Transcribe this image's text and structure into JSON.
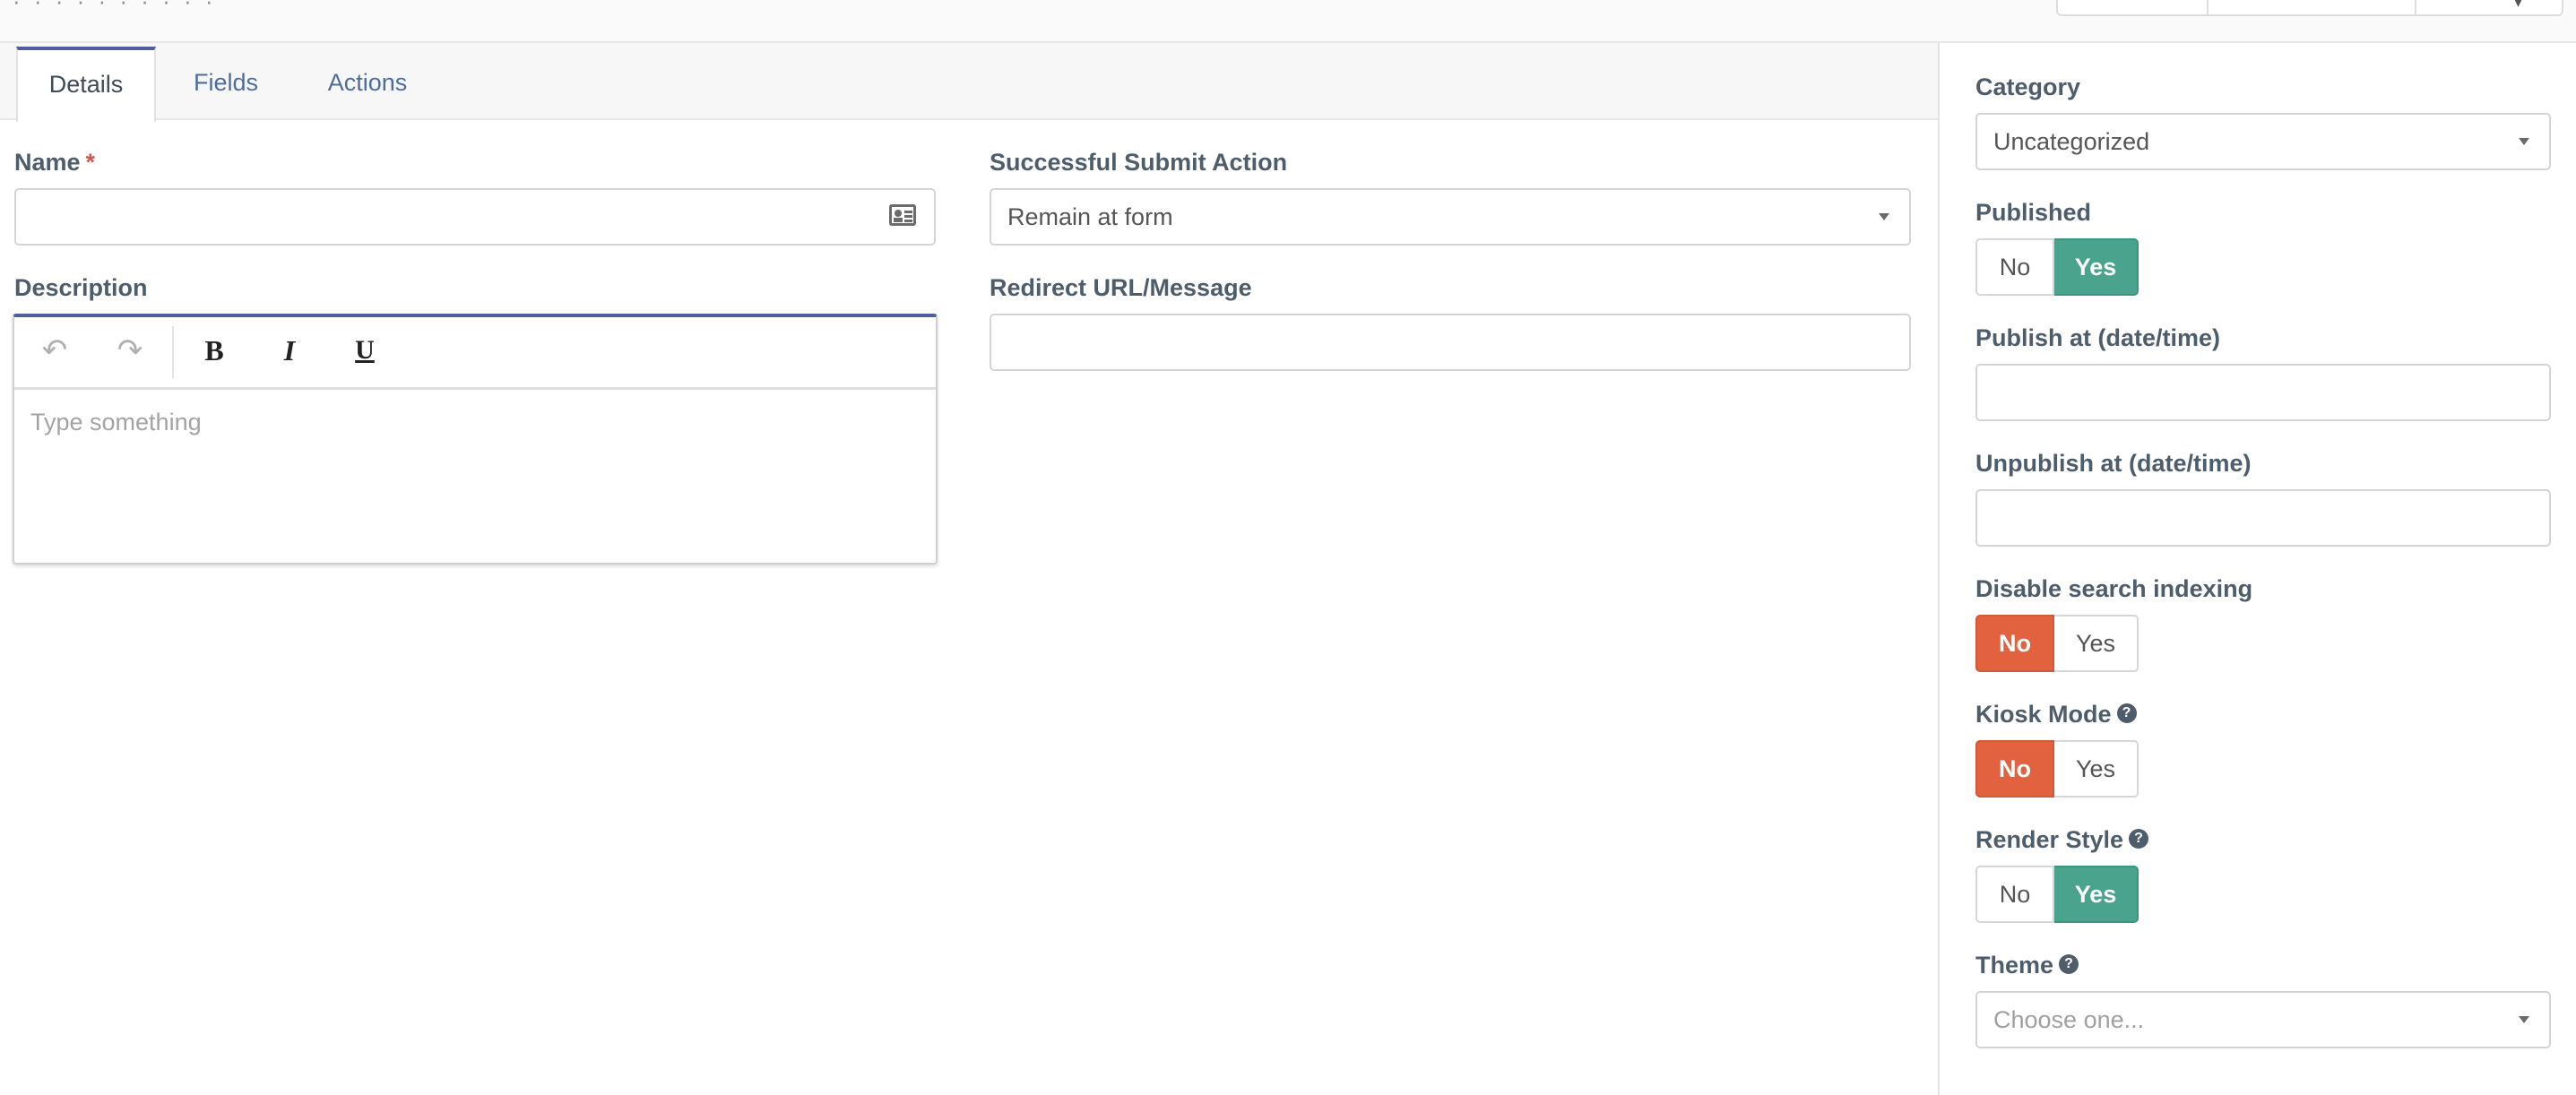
{
  "topbar": {
    "ghost_text": "· · · · · · · · · ·",
    "menu_glyph": "▾"
  },
  "tabs": [
    {
      "label": "Details",
      "active": true
    },
    {
      "label": "Fields",
      "active": false
    },
    {
      "label": "Actions",
      "active": false
    }
  ],
  "form": {
    "name": {
      "label": "Name",
      "required_mark": "*",
      "value": "",
      "icon": "contact-card-icon"
    },
    "description": {
      "label": "Description",
      "placeholder": "Type something",
      "toolbar": {
        "undo": "↶",
        "redo": "↷",
        "bold": "B",
        "italic": "I",
        "underline": "U"
      }
    },
    "submit_action": {
      "label": "Successful Submit Action",
      "value": "Remain at form"
    },
    "redirect": {
      "label": "Redirect URL/Message",
      "value": ""
    }
  },
  "sidebar": {
    "category": {
      "label": "Category",
      "value": "Uncategorized"
    },
    "published": {
      "label": "Published",
      "no": "No",
      "yes": "Yes",
      "selected": "yes"
    },
    "publish_at": {
      "label": "Publish at (date/time)",
      "value": ""
    },
    "unpublish_at": {
      "label": "Unpublish at (date/time)",
      "value": ""
    },
    "disable_search": {
      "label": "Disable search indexing",
      "no": "No",
      "yes": "Yes",
      "selected": "no"
    },
    "kiosk_mode": {
      "label": "Kiosk Mode",
      "help": "?",
      "no": "No",
      "yes": "Yes",
      "selected": "no"
    },
    "render_style": {
      "label": "Render Style",
      "help": "?",
      "no": "No",
      "yes": "Yes",
      "selected": "yes"
    },
    "theme": {
      "label": "Theme",
      "help": "?",
      "placeholder": "Choose one..."
    }
  },
  "colors": {
    "accent": "#4e5e9e",
    "toggle_yes": "#4aa38c",
    "toggle_no": "#e2623f",
    "required": "#d9534f"
  }
}
